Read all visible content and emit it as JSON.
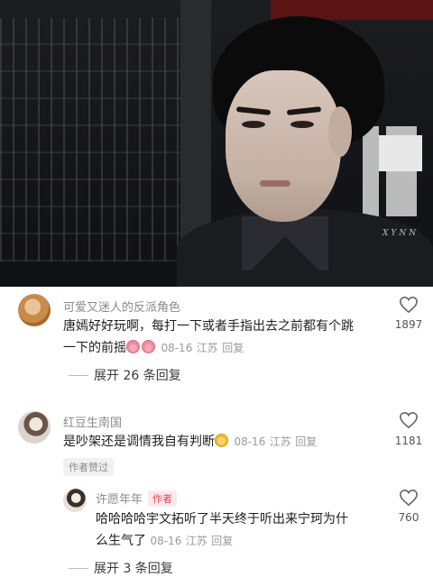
{
  "video": {
    "watermark": "XYNN"
  },
  "comments": [
    {
      "username": "可爱又迷人的反派角色",
      "text_line1": "唐嫣好好玩啊，每打一下或者手指出去之前都有个跳",
      "text_line2": "一下的前摇",
      "emojis": [
        "pig-emoji",
        "pig-emoji"
      ],
      "date": "08-16",
      "location": "江苏",
      "reply_label": "回复",
      "likes": "1897",
      "expand_label": "展开 26 条回复"
    },
    {
      "username": "红豆生南国",
      "text": "是吵架还是调情我自有判断",
      "emojis": [
        "cat-emoji"
      ],
      "date": "08-16",
      "location": "江苏",
      "reply_label": "回复",
      "likes": "1181",
      "author_liked": "作者赞过",
      "reply": {
        "username": "许愿年年",
        "author_tag": "作者",
        "text_line1": "哈哈哈哈宇文拓听了半天终于听出来宁珂为什",
        "text_line2": "么生气了",
        "date": "08-16",
        "location": "江苏",
        "reply_label": "回复",
        "likes": "760"
      },
      "expand_label": "展开 3 条回复"
    }
  ],
  "icons": {
    "like": "heart-outline-icon"
  }
}
